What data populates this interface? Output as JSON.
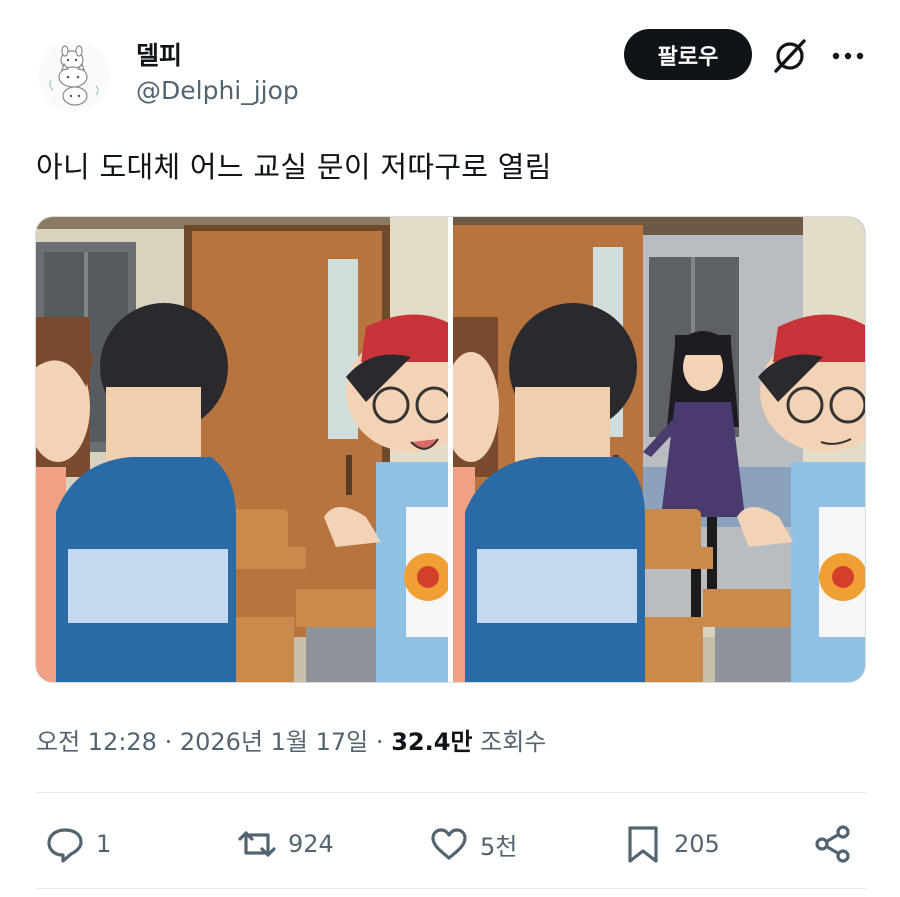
{
  "author": {
    "display_name": "델피",
    "handle": "@Delphi_jjop",
    "avatar_icon": "doodle-avatar-icon"
  },
  "header": {
    "follow_label": "팔로우",
    "grok_icon": "grok-slash-icon",
    "more_icon": "more-dots-icon"
  },
  "tweet": {
    "text": "아니 도대체 어느 교실 문이 저따구로 열림"
  },
  "media": {
    "panels": [
      {
        "scene": "classroom-door-closed"
      },
      {
        "scene": "classroom-door-open"
      }
    ]
  },
  "meta": {
    "time": "오전 12:28",
    "sep1": "·",
    "date": "2026년 1월 17일",
    "sep2": "·",
    "views_count": "32.4만",
    "views_label": "조회수"
  },
  "actions": {
    "reply_count": "1",
    "retweet_count": "924",
    "like_count": "5천",
    "bookmark_count": "205"
  },
  "colors": {
    "text_primary": "#0f1419",
    "text_secondary": "#536471",
    "follow_bg": "#0f1419",
    "divider": "#e6e9ec"
  }
}
